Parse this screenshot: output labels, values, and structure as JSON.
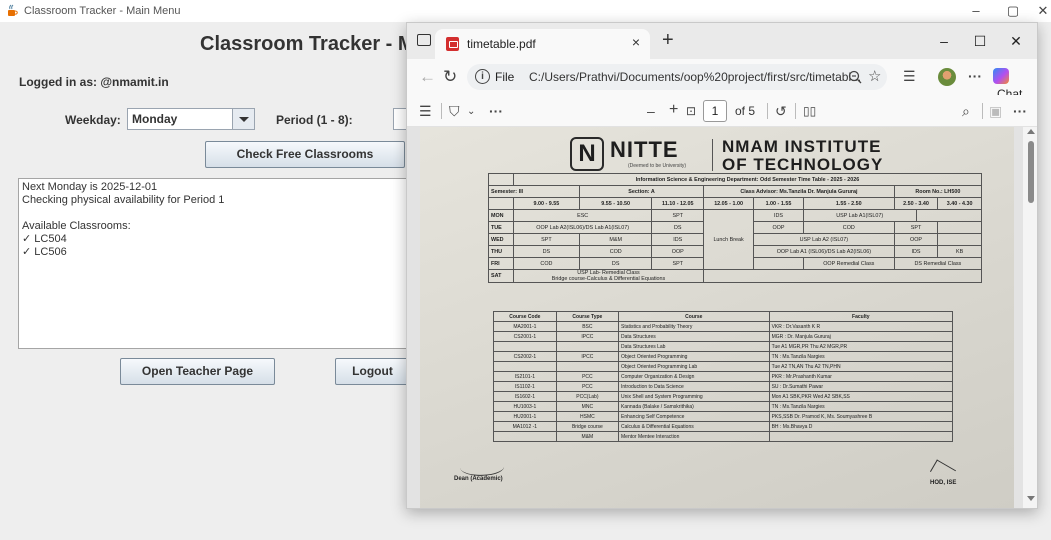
{
  "app": {
    "window_title": "Classroom Tracker - Main Menu",
    "heading": "Classroom Tracker - Main Menu",
    "logged_in": "Logged in as: @nmamit.in",
    "weekday_label": "Weekday:",
    "weekday_value": "Monday",
    "period_label": "Period (1 - 8):",
    "period_value": "",
    "check_button": "Check Free Classrooms",
    "result_lines": [
      "Next Monday is 2025-12-01",
      "Checking physical availability for Period 1",
      "",
      "Available Classrooms:",
      "✓ LC504",
      "✓ LC506"
    ],
    "teacher_button": "Open Teacher Page",
    "logout_button": "Logout",
    "controls": {
      "minimize": "–",
      "maximize": "▢",
      "close": "✕"
    }
  },
  "browser": {
    "tab_title": "timetable.pdf",
    "tab_close": "×",
    "new_tab": "+",
    "address_scheme": "File",
    "address_url": "C:/Users/Prathvi/Documents/oop%20project/first/src/timetabl...",
    "chat_label": "Chat",
    "page_current": "1",
    "page_of": "of 5",
    "zoom_out": "–",
    "zoom_in": "+",
    "controls": {
      "minimize": "–",
      "maximize": "☐",
      "close": "✕"
    }
  },
  "pdf": {
    "logo_text": "NITTE",
    "logo_sub": "(Deemed to be University)",
    "institute_line1": "NMAM INSTITUTE",
    "institute_line2": "OF TECHNOLOGY",
    "header_row": "Information Science & Engineering  Department: Odd Semester Time Table - 2025 - 2026",
    "semester": "Semester: III",
    "section": "Section: A",
    "advisor": "Class Advisor: Ms.Tanzila Dr. Manjula Gururaj",
    "room": "Room No.: LH500",
    "slots": [
      "9.00 - 9.55",
      "9.55 - 10.50",
      "11.10 - 12.05",
      "12.05 - 1.00",
      "1.00 - 1.55",
      "1.55 - 2.50",
      "2.50 - 3.40",
      "3.40 - 4.30"
    ],
    "days": {
      "mon": [
        "MON",
        "ESC",
        "SPT",
        "IDS",
        "USP Lab A1(ISL07)"
      ],
      "tue": [
        "TUE",
        "OOP Lab A2(ISL06)/DS Lab A1(ISL07)",
        "DS",
        "OOP",
        "COD",
        "SPT"
      ],
      "wed": [
        "WED",
        "SPT",
        "M&M",
        "IDS",
        "USP Lab A2 (ISL07)",
        "OOP"
      ],
      "thu": [
        "THU",
        "DS",
        "COD",
        "OOP",
        "OOP Lab A1 (ISL06)/DS Lab A2(ISL06)",
        "IDS",
        "KB"
      ],
      "fri": [
        "FRI",
        "COD",
        "DS",
        "SPT",
        "OOP Remedial Class",
        "DS Remedial Class"
      ],
      "sat": [
        "SAT",
        "USP Lab- Remedial Class",
        "Bridge course-Calculus & Differential Equations"
      ]
    },
    "lunch": "Lunch Break",
    "course_headers": [
      "Course Code",
      "Course Type",
      "Course",
      "Faculty"
    ],
    "courses": [
      [
        "MA2001-1",
        "BSC",
        "Statistics and Probability Theory",
        "VKR : Dr.Vasanth K R"
      ],
      [
        "CS2001-1",
        "IPCC",
        "Data Structures",
        "MGR : Dr. Manjula Gururaj"
      ],
      [
        "",
        "",
        "Data Structures Lab",
        "Tue  A1  MGR,PR   Thu  A2  MGR,PR"
      ],
      [
        "CS2002-1",
        "IPCC",
        "Object Oriented Programming",
        "TN : Ms.Tanzila Nargies"
      ],
      [
        "",
        "",
        "Object Oriented Programming Lab",
        "Tue  A2  TN,AN   Thu  A2  TN,PHN"
      ],
      [
        "IS2101-1",
        "PCC",
        "Computer Organization & Design",
        "PKR : Mr.Prashanth Kumar"
      ],
      [
        "IS1102-1",
        "PCC",
        "Introduction to Data Science",
        "SU : Dr.Sumathi Pawar"
      ],
      [
        "IS1602-1",
        "PCC(Lab)",
        "Unix Shell and System Programming",
        "Mon  A1  SBK,PKR   Wed  A2  SBK,SS"
      ],
      [
        "HU1003-1",
        "MNC",
        "Kannada (Balake / Samskrithika)",
        "TN : Ms.Tanzila Nargies"
      ],
      [
        "HU2001-1",
        "HSMC",
        "Enhancing Self Competence",
        "PKS,SSB Dr. Pramod K, Ms. Soumyashree B"
      ],
      [
        "MA1012 -1",
        "Bridge course",
        "Calculus & Differential Equations",
        "BH : Ms.Bhavya D"
      ],
      [
        "",
        "M&M",
        "Mentor Mentee Interaction",
        ""
      ]
    ],
    "sign_left": "Dean (Academic)",
    "sign_right": "HOD, ISE"
  }
}
